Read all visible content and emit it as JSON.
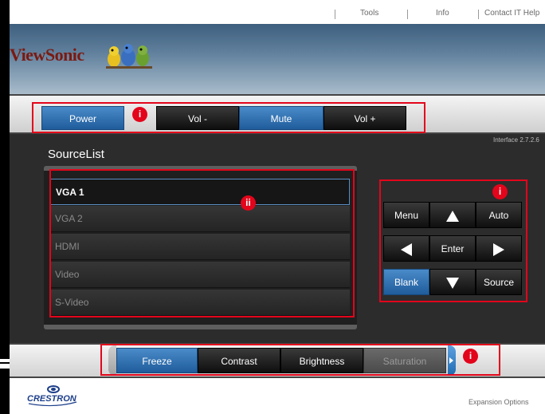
{
  "topnav": {
    "tools": "Tools",
    "info": "Info",
    "contact": "Contact IT Help"
  },
  "banner": {
    "logo": "ViewSonic"
  },
  "controls": {
    "power": "Power",
    "vol_down": "Vol -",
    "mute": "Mute",
    "vol_up": "Vol +"
  },
  "interface_version": "Interface 2.7.2.6",
  "source_list": {
    "title": "SourceList",
    "items": [
      "VGA 1",
      "VGA 2",
      "HDMI",
      "Video",
      "S-Video"
    ]
  },
  "remote": {
    "menu": "Menu",
    "up_icon": "arrow-up-icon",
    "auto": "Auto",
    "left_icon": "arrow-left-icon",
    "enter": "Enter",
    "right_icon": "arrow-right-icon",
    "blank": "Blank",
    "down_icon": "arrow-down-icon",
    "source": "Source"
  },
  "adjust": {
    "freeze": "Freeze",
    "contrast": "Contrast",
    "brightness": "Brightness",
    "saturation": "Saturation"
  },
  "footer": {
    "brand": "CRESTRON",
    "expansion": "Expansion Options"
  },
  "annotations": {
    "i": "i",
    "ii": "ii"
  },
  "colors": {
    "accent_blue": "#2f6fb0",
    "annotation_red": "#e3051b",
    "logo_red": "#7a1a12"
  }
}
